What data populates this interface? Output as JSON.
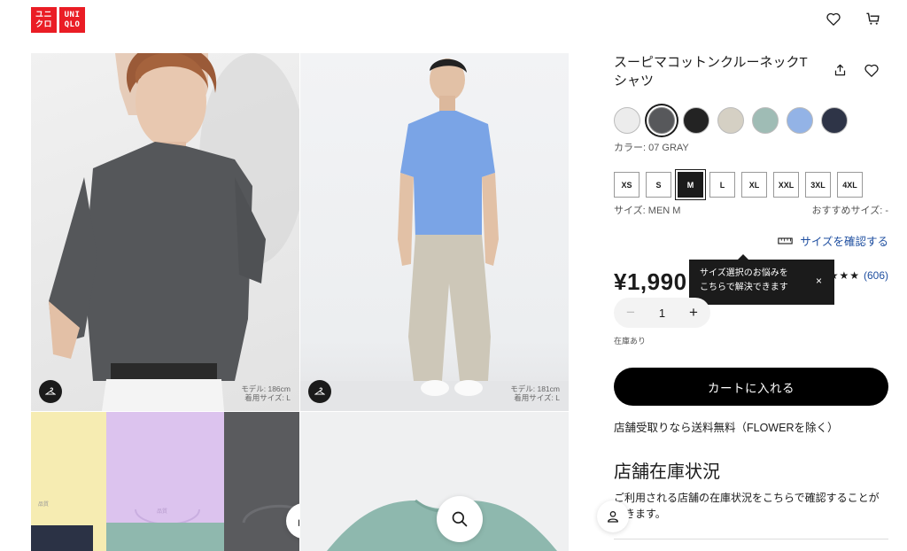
{
  "header": {
    "logo_lines": [
      "ユニ\nクロ",
      "UNI\nQLO"
    ],
    "logo_color": "#ea1d25",
    "icons": [
      "heart-icon",
      "cart-icon"
    ]
  },
  "gallery": {
    "images": [
      {
        "name": "model-front-gray",
        "model_height": "モデル: 186cm",
        "model_size": "着用サイズ: L"
      },
      {
        "name": "model-standing-blue",
        "model_height": "モデル: 181cm",
        "model_size": "着用サイズ: L"
      },
      {
        "name": "folded-colors",
        "tag1": "品質",
        "tag2": "品質"
      },
      {
        "name": "flat-green"
      }
    ]
  },
  "product": {
    "title": "スーピマコットンクルーネックTシャツ",
    "colors": [
      {
        "name": "white",
        "hex": "#ececec"
      },
      {
        "name": "gray",
        "hex": "#57585b",
        "selected": true
      },
      {
        "name": "black",
        "hex": "#232323"
      },
      {
        "name": "beige",
        "hex": "#d5d0c4"
      },
      {
        "name": "green",
        "hex": "#9fbcb5"
      },
      {
        "name": "blue",
        "hex": "#93b3e6"
      },
      {
        "name": "navy",
        "hex": "#2e3447"
      }
    ],
    "color_label": "カラー: 07 GRAY",
    "sizes": [
      "XS",
      "S",
      "M",
      "L",
      "XL",
      "XXL",
      "3XL",
      "4XL"
    ],
    "selected_size": "M",
    "size_label": "サイズ: MEN M",
    "recommended_size": "おすすめサイズ: -",
    "size_check_link": "サイズを確認する",
    "price": "¥1,990",
    "tooltip_line1": "サイズ選択のお悩みを",
    "tooltip_line2": "こちらで解決できます",
    "tooltip_close": "×",
    "stars": "★★★★★",
    "rating": 4.5,
    "reviews": "(606)",
    "quantity": "1",
    "qty_minus": "−",
    "qty_plus": "+",
    "stock_status": "在庫あり",
    "cart_button": "カートに入れる",
    "pickup_note": "店舗受取りなら送料無料（FLOWERを除く）",
    "store_stock_title": "店舗在庫状況",
    "store_stock_desc": "ご利用される店舗の在庫状況をこちらで確認することができます。"
  }
}
